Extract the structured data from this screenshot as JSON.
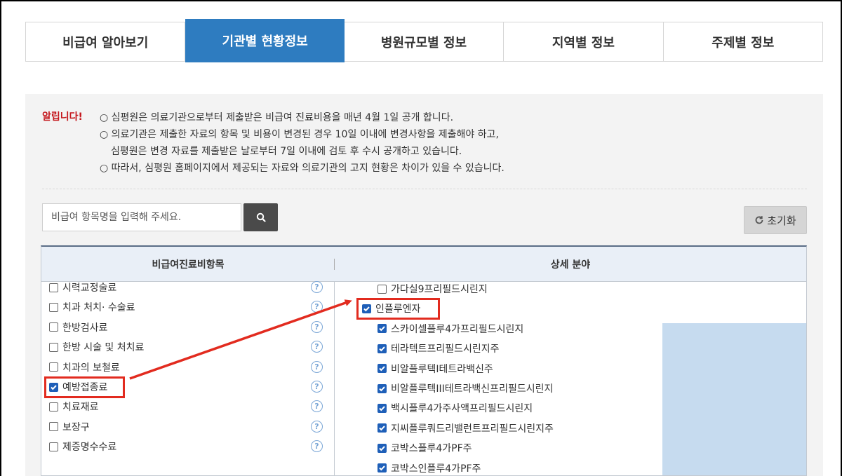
{
  "tabs": [
    {
      "label": "비급여 알아보기"
    },
    {
      "label": "기관별 현황정보"
    },
    {
      "label": "병원규모별 정보"
    },
    {
      "label": "지역별 정보"
    },
    {
      "label": "주제별 정보"
    }
  ],
  "notice": {
    "label": "알립니다!",
    "lines": [
      "○ 심평원은 의료기관으로부터 제출받은 비급여 진료비용을 매년 4월 1일 공개 합니다.",
      "○ 의료기관은 제출한 자료의 항목 및 비용이 변경된 경우 10일 이내에 변경사항을 제출해야 하고,",
      "심평원은 변경 자료를 제출받은 날로부터 7일 이내에 검토 후 수시 공개하고 있습니다.",
      "○ 따라서, 심평원 홈페이지에서 제공되는 자료와 의료기관의 고지 현황은 차이가 있을 수 있습니다."
    ]
  },
  "search": {
    "placeholder": "비급여 항목명을 입력해 주세요."
  },
  "reset_label": "초기화",
  "table": {
    "header_left": "비급여진료비항목",
    "header_right": "상세 분야",
    "left_items": [
      {
        "label": "시력교정술료",
        "checked": false
      },
      {
        "label": "치과 처치· 수술료",
        "checked": false
      },
      {
        "label": "한방검사료",
        "checked": false
      },
      {
        "label": "한방 시술 및 처치료",
        "checked": false
      },
      {
        "label": "치과의 보철료",
        "checked": false
      },
      {
        "label": "예방접종료",
        "checked": true
      },
      {
        "label": "치료재료",
        "checked": false
      },
      {
        "label": "보장구",
        "checked": false
      },
      {
        "label": "제증명수수료",
        "checked": false
      }
    ],
    "right_items": [
      {
        "label": "가다실9프리필드시린지",
        "checked": false
      },
      {
        "label": "인플루엔자",
        "checked": true
      },
      {
        "label": "스카이셀플루4가프리필드시린지",
        "checked": true
      },
      {
        "label": "테라텍트프리필드시린지주",
        "checked": true
      },
      {
        "label": "비알플루텍I테트라백신주",
        "checked": true
      },
      {
        "label": "비알플루텍III테트라백신프리필드시린지",
        "checked": true
      },
      {
        "label": "백시플루4가주사액프리필드시린지",
        "checked": true
      },
      {
        "label": "지씨플루쿼드리밸런트프리필드시린지주",
        "checked": true
      },
      {
        "label": "코박스플루4가PF주",
        "checked": true
      },
      {
        "label": "코박스인플루4가PF주",
        "checked": true
      }
    ]
  },
  "colors": {
    "tab_active": "#2e7cc0",
    "highlight": "#e22b1f",
    "selection": "#c6dbef",
    "notice_label": "#c4161c"
  }
}
